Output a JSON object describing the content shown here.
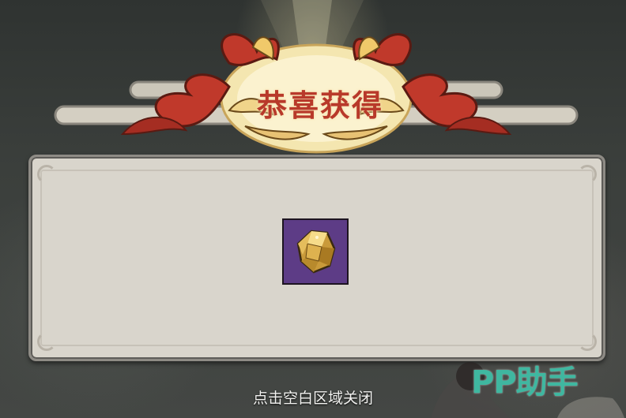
{
  "popup": {
    "title": "恭喜获得",
    "close_hint": "点击空白区域关闭"
  },
  "reward": {
    "icon": "gold-ore-icon",
    "rarity_color": "#5d3c86"
  },
  "watermark": {
    "text": "PP助手",
    "color": "#3fb7a0"
  },
  "colors": {
    "banner_red": "#b8392a",
    "panel_bg": "#d9d5cc",
    "background": "#3a3d3b"
  }
}
